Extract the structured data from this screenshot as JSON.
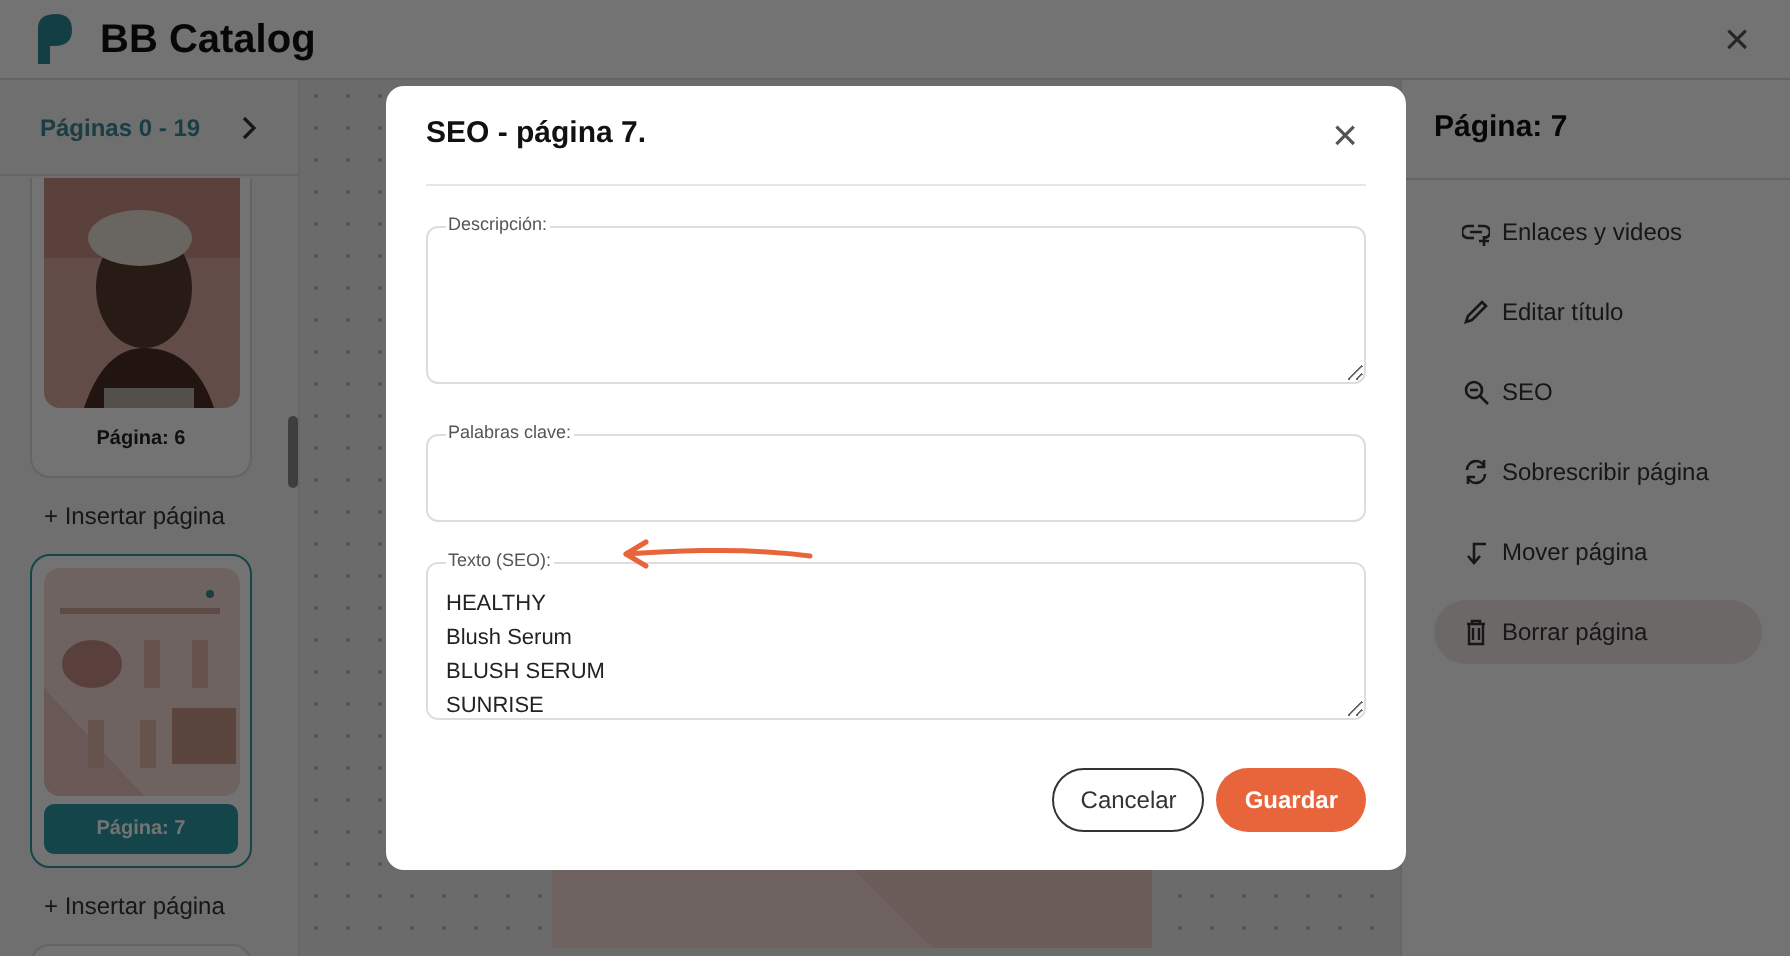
{
  "app": {
    "title": "BB Catalog",
    "close": "×"
  },
  "sidebar": {
    "range_label": "Páginas 0 - 19",
    "pages": [
      {
        "label": "Página: 6",
        "selected": false,
        "kind": "picture",
        "insert_label": "+ Insertar página"
      },
      {
        "label": "Página: 7",
        "selected": true,
        "kind": "picture",
        "insert_label": "+ Insertar página"
      }
    ]
  },
  "right_panel": {
    "title": "Página: 7",
    "actions": [
      {
        "label": "Enlaces y videos",
        "kind": "link",
        "selected": false
      },
      {
        "label": "Editar título",
        "kind": "edit",
        "selected": false
      },
      {
        "label": "SEO",
        "kind": "seo",
        "selected": false
      },
      {
        "label": "Sobrescribir página",
        "kind": "overwrite",
        "selected": false
      },
      {
        "label": "Mover página",
        "kind": "move",
        "selected": false
      },
      {
        "label": "Borrar página",
        "kind": "delete",
        "selected": true
      }
    ]
  },
  "dialog": {
    "title": "SEO - página 7.",
    "close": "×",
    "fields": [
      {
        "label": "Descripción:",
        "kind": "textarea"
      },
      {
        "label": "Palabras clave:",
        "kind": "input"
      },
      {
        "label": "Texto (SEO):",
        "kind": "textarea",
        "value": "HEALTHY\nBlush Serum\nBLUSH SERUM\nSUNRISE"
      }
    ],
    "buttons": [
      {
        "label": "Cancelar",
        "kind": "secondary"
      },
      {
        "label": "Guardar",
        "kind": "primary"
      }
    ]
  }
}
